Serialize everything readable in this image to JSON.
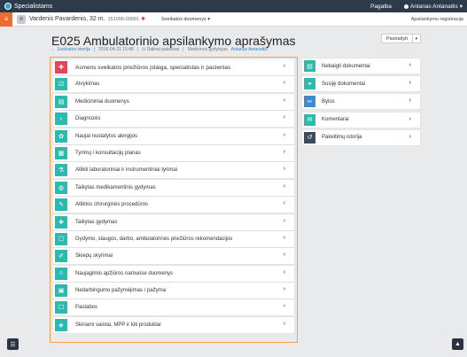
{
  "topbar": {
    "brand": "Specialistams",
    "help": "Pagalba",
    "user": "Antanas Antanaitis"
  },
  "patient": {
    "name": "Vardenis Pavardenis, 32 m.",
    "id": "151006-00001",
    "star": "✱",
    "health_data": "Sveikatos duomenys",
    "registration": "Apsilankymo registracija"
  },
  "page": {
    "title": "E025 Ambulatorinio apsilankymo aprašymas",
    "history_link": "← Sveikatos istorija",
    "datetime": "2016-04-21 15:48",
    "status": "⊙ Dalinai pateiktas",
    "doctor_label": "Medicinos gydytojas",
    "doctor_name": "Antanas Antanaitis",
    "sign_button": "Pasirašyti"
  },
  "left_items": [
    {
      "label": "Asmens sveikatos priežiūros įstaiga, specialistas ir pacientas",
      "icon": "plus-icon",
      "color": "#e54559"
    },
    {
      "label": "Atvykimas",
      "icon": "checkin-icon",
      "color": "#2cb9ae"
    },
    {
      "label": "Medicininiai duomenys",
      "icon": "document-icon",
      "color": "#2cb9ae"
    },
    {
      "label": "Diagnozės",
      "icon": "stethoscope-icon",
      "color": "#2cb9ae"
    },
    {
      "label": "Naujai nustatytos alergijos",
      "icon": "allergy-icon",
      "color": "#2cb9ae"
    },
    {
      "label": "Tyrimų / konsultacijų planas",
      "icon": "calendar-icon",
      "color": "#2cb9ae"
    },
    {
      "label": "Atlikti laboratoriniai ir instrumentiniai tyrimai",
      "icon": "lab-icon",
      "color": "#2cb9ae"
    },
    {
      "label": "Taikytas medikamentinis gydymas",
      "icon": "pill-icon",
      "color": "#2cb9ae"
    },
    {
      "label": "Atliktos chirurginės procedūros",
      "icon": "scalpel-icon",
      "color": "#2cb9ae"
    },
    {
      "label": "Taikytas gydymas",
      "icon": "treatment-icon",
      "color": "#2cb9ae"
    },
    {
      "label": "Gydymo, slaugos, darbo, ambulatorinės priežiūros rekomendacijos",
      "icon": "recommendation-icon",
      "color": "#2cb9ae"
    },
    {
      "label": "Skiepų skyrimai",
      "icon": "syringe-icon",
      "color": "#2cb9ae"
    },
    {
      "label": "Naujagimio apžiūros namuose duomenys",
      "icon": "baby-icon",
      "color": "#2cb9ae"
    },
    {
      "label": "Nedarbingumo pažymėjimas / pažyma",
      "icon": "certificate-icon",
      "color": "#2cb9ae"
    },
    {
      "label": "Pastabos",
      "icon": "note-icon",
      "color": "#2cb9ae"
    },
    {
      "label": "Skiriami vaistai, MPP ir kiti produktai",
      "icon": "medicine-icon",
      "color": "#2cb9ae"
    }
  ],
  "right_items": [
    {
      "label": "Nebaigti dokumentai",
      "icon": "unfinished-docs-icon",
      "color": "#2cb9ae"
    },
    {
      "label": "Susiję dokumentai",
      "icon": "link-icon",
      "color": "#2cb9ae"
    },
    {
      "label": "Bylos",
      "icon": "paperclip-icon",
      "color": "#3a8dd1"
    },
    {
      "label": "Komentarai",
      "icon": "comment-icon",
      "color": "#2cb9ae"
    },
    {
      "label": "Pakeitimų istorija",
      "icon": "history-icon",
      "color": "#3b4a5c"
    }
  ]
}
